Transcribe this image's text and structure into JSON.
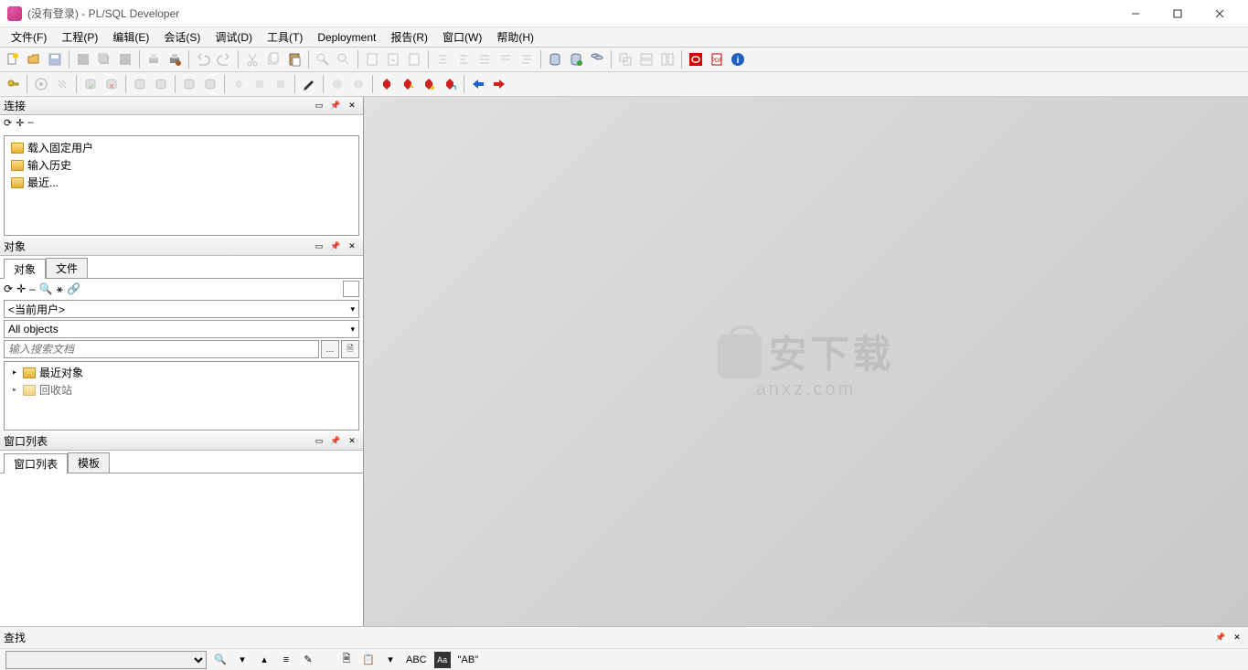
{
  "window": {
    "title": "(没有登录) - PL/SQL Developer"
  },
  "menubar": {
    "items": [
      "文件(F)",
      "工程(P)",
      "编辑(E)",
      "会话(S)",
      "调试(D)",
      "工具(T)",
      "Deployment",
      "报告(R)",
      "窗口(W)",
      "帮助(H)"
    ]
  },
  "panels": {
    "connect": {
      "title": "连接",
      "tree": [
        "载入固定用户",
        "输入历史",
        "最近..."
      ]
    },
    "objects": {
      "title": "对象",
      "tabs": [
        "对象",
        "文件"
      ],
      "user_dropdown": "<当前用户>",
      "filter_dropdown": "All objects",
      "search_placeholder": "输入搜索文档",
      "tree": [
        "最近对象",
        "回收站"
      ]
    },
    "winlist": {
      "title": "窗口列表",
      "tabs": [
        "窗口列表",
        "模板"
      ]
    },
    "find": {
      "title": "查找"
    }
  },
  "watermark": {
    "text": "安下载",
    "sub": "anxz.com"
  },
  "findbar": {
    "abc": "ABC",
    "ab": "\"AB\""
  }
}
